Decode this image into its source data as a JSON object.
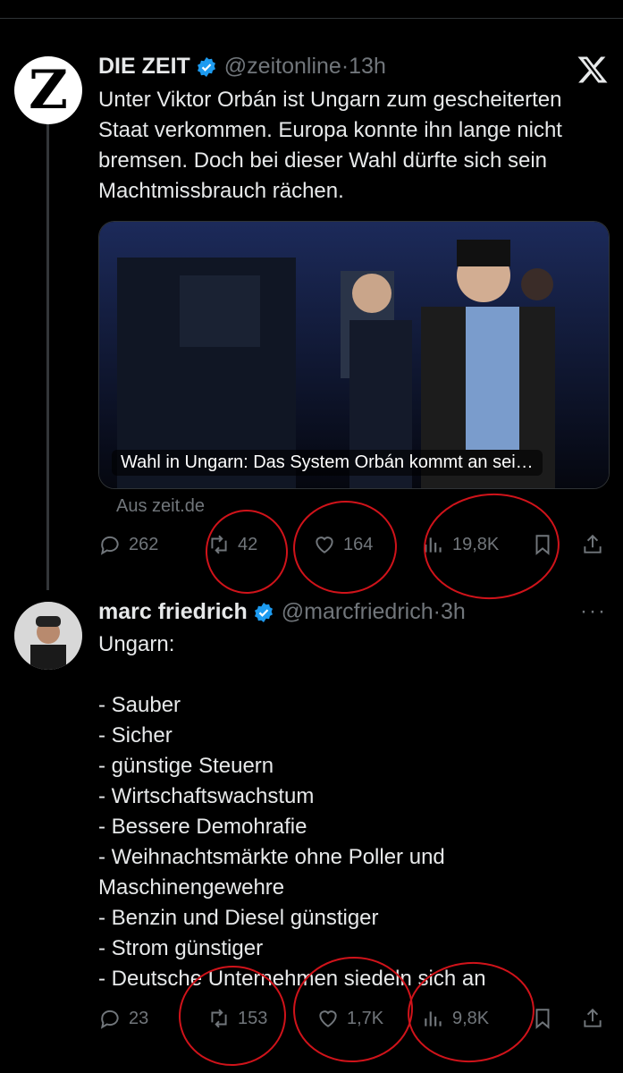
{
  "tweet1": {
    "name": "DIE ZEIT",
    "handle": "@zeitonline",
    "dot": "·",
    "time": "13h",
    "avatar_letter": "Z",
    "text": "Unter Viktor Orbán ist Ungarn zum gescheiterten Staat verkommen. Europa konnte ihn lange nicht bremsen. Doch bei dieser Wahl dürfte sich sein Machtmissbrauch rächen.",
    "card_caption": "Wahl in Ungarn: Das System Orbán kommt an sei…",
    "source": "Aus zeit.de",
    "replies": "262",
    "reposts": "42",
    "likes": "164",
    "views": "19,8K"
  },
  "tweet2": {
    "name": "marc friedrich",
    "handle": "@marcfriedrich",
    "dot": "·",
    "time": "3h",
    "more": "···",
    "text": "Ungarn:\n\n- Sauber\n- Sicher\n- günstige Steuern\n- Wirtschaftswachstum\n- Bessere Demohrafie\n- Weihnachtsmärkte ohne Poller und Maschinengewehre\n- Benzin und Diesel günstiger\n- Strom günstiger\n- Deutsche Unternehmen siedeln sich an",
    "replies": "23",
    "reposts": "153",
    "likes": "1,7K",
    "views": "9,8K"
  },
  "colors": {
    "verified": "#1d9bf0",
    "muted": "#71767b",
    "annotation": "#d0131a"
  },
  "icons": [
    "verified-badge-icon",
    "x-logo-icon",
    "reply-icon",
    "repost-icon",
    "like-icon",
    "views-icon",
    "bookmark-icon",
    "share-icon"
  ]
}
